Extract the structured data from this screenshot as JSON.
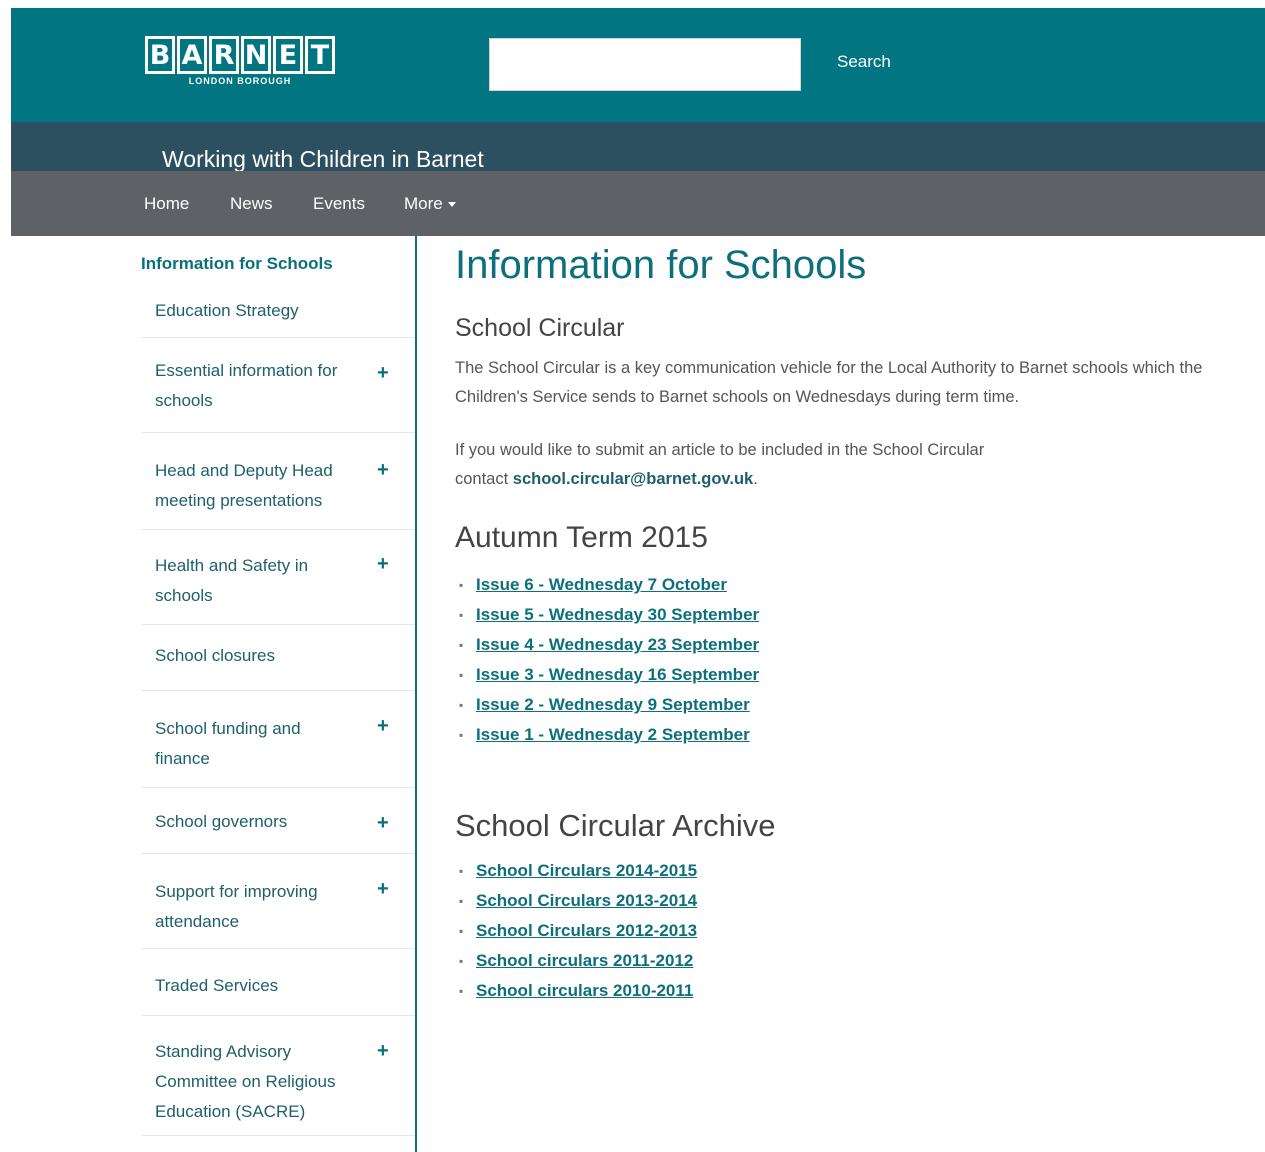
{
  "header": {
    "logo": {
      "letters": [
        "B",
        "A",
        "R",
        "N",
        "E",
        "T"
      ],
      "subtitle": "LONDON BOROUGH"
    },
    "search": {
      "placeholder": "",
      "value": "",
      "button_label": "Search"
    }
  },
  "site_title": "Working with Children in Barnet",
  "nav": {
    "items": [
      "Home",
      "News",
      "Events"
    ],
    "more_label": "More"
  },
  "sidebar": {
    "heading": "Information for Schools",
    "items": [
      {
        "label": "Education Strategy",
        "expandable": false
      },
      {
        "label": "Essential information for schools",
        "expandable": true
      },
      {
        "label": "Head and Deputy Head meeting presentations",
        "expandable": true
      },
      {
        "label": "Health and Safety in schools",
        "expandable": true
      },
      {
        "label": "School closures",
        "expandable": false
      },
      {
        "label": "School funding and finance",
        "expandable": true
      },
      {
        "label": "School governors",
        "expandable": true
      },
      {
        "label": "Support for improving attendance",
        "expandable": true
      },
      {
        "label": "Traded Services",
        "expandable": false
      },
      {
        "label": "Standing Advisory Committee on Religious Education (SACRE)",
        "expandable": true
      }
    ]
  },
  "main": {
    "title": "Information for Schools",
    "circular": {
      "heading": "School Circular",
      "intro": "The School Circular is a key communication vehicle for the Local Authority to Barnet schools which the Children's Service sends to Barnet schools on Wednesdays during term time.",
      "submit_text": "If you would like to submit an article to be included in the School Circular",
      "contact_prefix": "contact ",
      "contact_email": "school.circular@barnet.gov.uk",
      "contact_suffix": "."
    },
    "autumn": {
      "heading": "Autumn Term 2015",
      "issues": [
        "Issue 6 - Wednesday 7 October",
        "Issue 5 - Wednesday 30 September",
        "Issue 4 - Wednesday 23 September",
        "Issue 3 - Wednesday 16 September",
        "Issue 2 - Wednesday 9 September",
        "Issue 1 - Wednesday 2 September"
      ]
    },
    "archive": {
      "heading": "School Circular Archive",
      "links": [
        "School Circulars 2014-2015",
        "School Circulars 2013-2014",
        "School Circulars 2012-2013",
        "School circulars 2011-2012",
        "School circulars 2010-2011"
      ]
    }
  },
  "colors": {
    "header_teal": "#017582",
    "site_band": "#2d5060",
    "nav_grey": "#5e6166",
    "accent_teal": "#0e6f7c"
  },
  "icons": {
    "expand": "plus-icon",
    "nav_more": "caret-down-icon",
    "list": "bullet-icon"
  }
}
